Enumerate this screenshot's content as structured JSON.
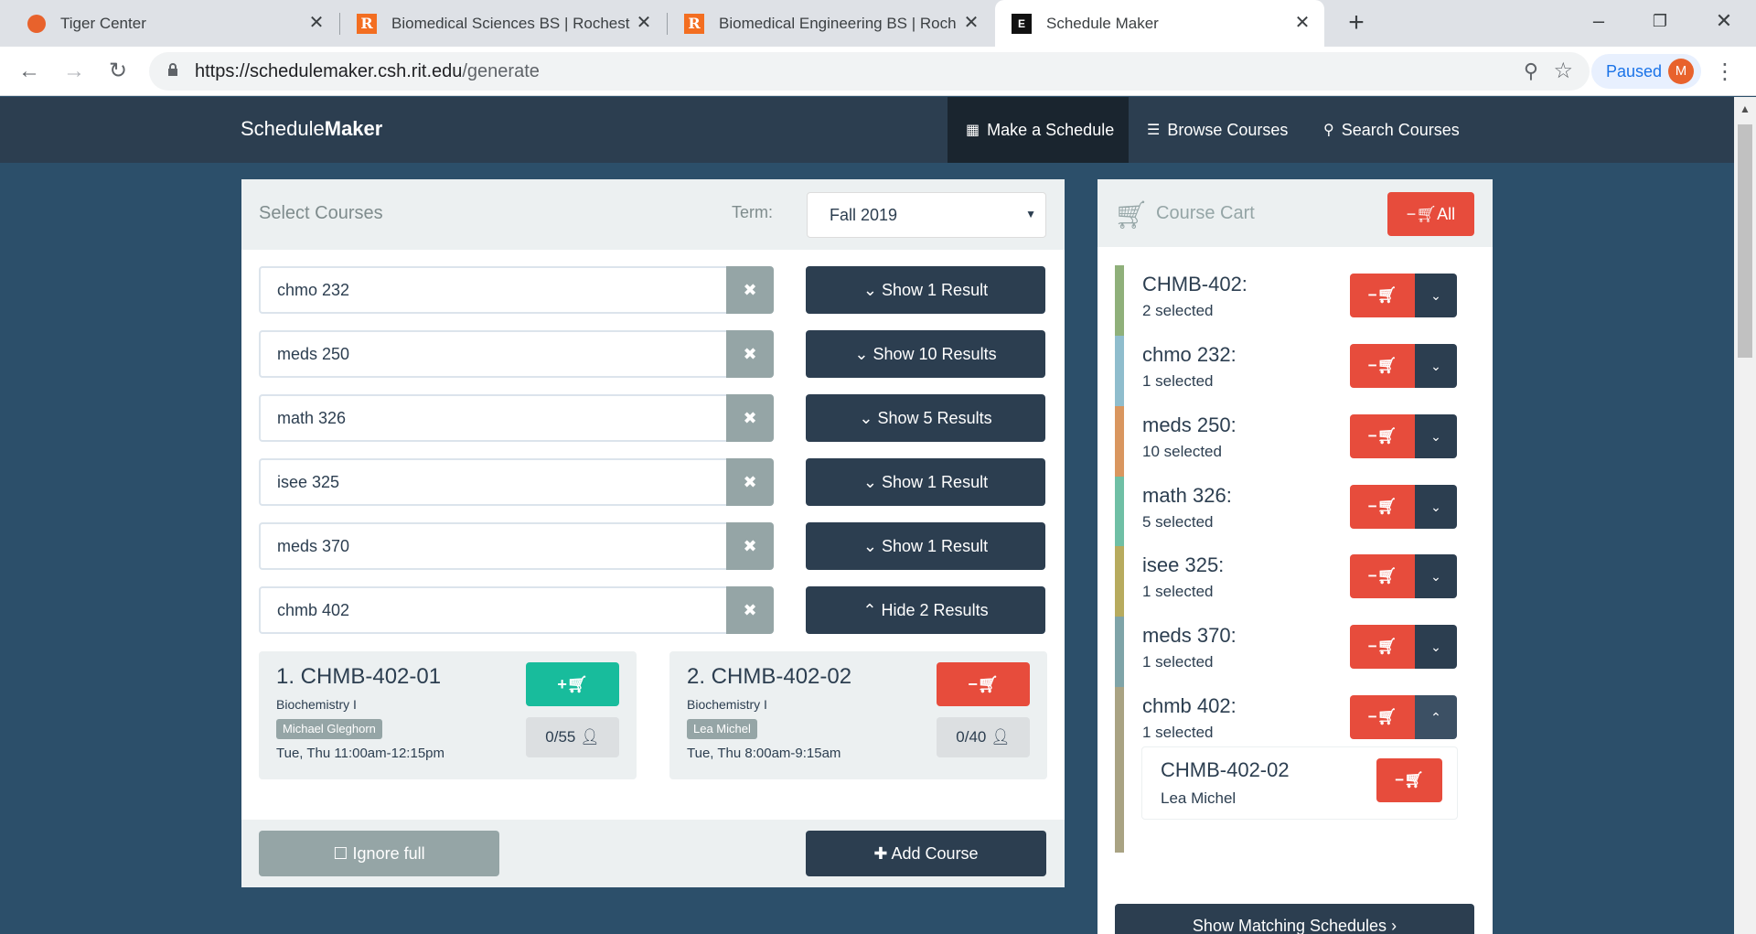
{
  "browser": {
    "tabs": [
      {
        "title": "Tiger Center",
        "favicon": "tiger-favicon"
      },
      {
        "title": "Biomedical Sciences BS | Rochest",
        "favicon": "rit-favicon"
      },
      {
        "title": "Biomedical Engineering BS | Roch",
        "favicon": "rit-favicon"
      },
      {
        "title": "Schedule Maker",
        "favicon": "schedulemaker-favicon"
      }
    ],
    "url_host": "https://schedulemaker.csh.rit.edu",
    "url_path": "/generate",
    "profile_status": "Paused",
    "profile_initial": "M"
  },
  "nav": {
    "brand_light": "Schedule",
    "brand_bold": "Maker",
    "items": [
      {
        "label": "Make a Schedule",
        "icon": "calendar-icon",
        "active": true
      },
      {
        "label": "Browse Courses",
        "icon": "list-icon"
      },
      {
        "label": "Search Courses",
        "icon": "search-icon"
      }
    ]
  },
  "select": {
    "title": "Select Courses",
    "term_label": "Term:",
    "term_value": "Fall 2019",
    "courses": [
      {
        "query": "chmo 232",
        "toggle": "Show 1 Result"
      },
      {
        "query": "meds 250",
        "toggle": "Show 10 Results"
      },
      {
        "query": "math 326",
        "toggle": "Show 5 Results"
      },
      {
        "query": "isee 325",
        "toggle": "Show 1 Result"
      },
      {
        "query": "meds 370",
        "toggle": "Show 1 Result"
      },
      {
        "query": "chmb 402",
        "toggle": "Hide 2 Results"
      }
    ],
    "results": [
      {
        "title": "1. CHMB-402-01",
        "name": "Biochemistry I",
        "instructor": "Michael Gleghorn",
        "time": "Tue, Thu 11:00am-12:15pm",
        "seats": "0/55",
        "in_cart": false
      },
      {
        "title": "2. CHMB-402-02",
        "name": "Biochemistry I",
        "instructor": "Lea Michel",
        "time": "Tue, Thu 8:00am-9:15am",
        "seats": "0/40",
        "in_cart": true
      }
    ],
    "ignore_full": "Ignore full",
    "add_course": "Add Course"
  },
  "cart": {
    "title": "Course Cart",
    "remove_all": "All",
    "items": [
      {
        "name": "CHMB-402:",
        "count": "2 selected",
        "color": "#8fb07a"
      },
      {
        "name": "chmo 232:",
        "count": "1 selected",
        "color": "#8fbdcd"
      },
      {
        "name": "meds 250:",
        "count": "10 selected",
        "color": "#d9965f"
      },
      {
        "name": "math 326:",
        "count": "5 selected",
        "color": "#6fbfa5"
      },
      {
        "name": "isee 325:",
        "count": "1 selected",
        "color": "#b7ab5e"
      },
      {
        "name": "meds 370:",
        "count": "1 selected",
        "color": "#7fa4a8"
      },
      {
        "name": "chmb 402:",
        "count": "1 selected",
        "color": "#a9a383"
      }
    ],
    "expanded_section": {
      "code": "CHMB-402-02",
      "instructor": "Lea Michel"
    },
    "show_matching": "Show Matching Schedules"
  }
}
